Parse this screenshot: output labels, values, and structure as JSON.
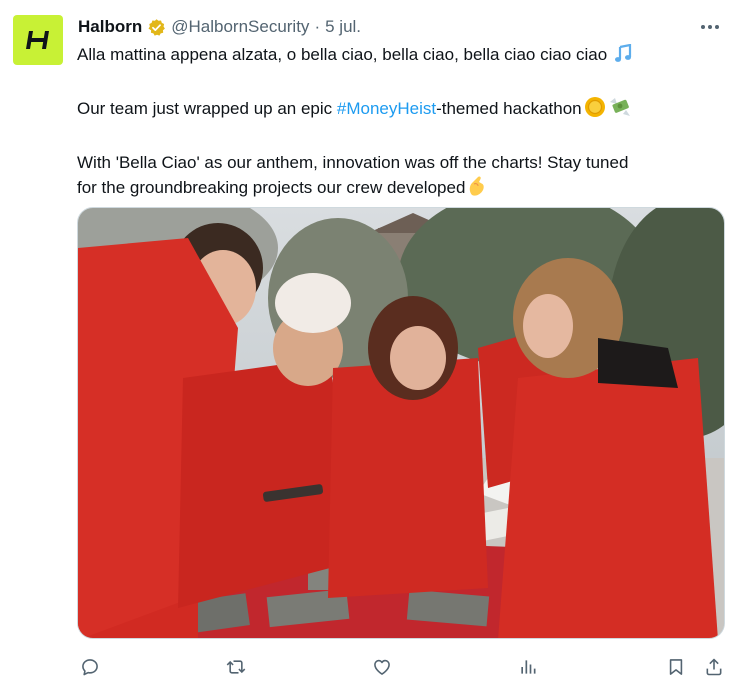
{
  "tweet": {
    "author": {
      "display_name": "Halborn",
      "handle": "@HalbornSecurity",
      "verified": true,
      "avatar_icon": "halborn-logo-icon",
      "avatar_color": "#c8f135"
    },
    "separator": "·",
    "date": "5 jul.",
    "lines": {
      "line1": "Alla mattina appena alzata, o bella ciao, bella ciao, bella ciao ciao ciao",
      "line2_before": "Our team just wrapped up an epic ",
      "hashtag": "#MoneyHeist",
      "line2_after": "-themed hackathon",
      "line3_a": "With 'Bella Ciao' as our anthem, innovation was off the charts! Stay tuned",
      "line3_b": "for the groundbreaking projects our crew developed"
    },
    "emojis": [
      "music-notes-icon",
      "coin-icon",
      "money-with-wings-icon",
      "pinching-hand-icon"
    ],
    "colors": {
      "accent": "#1d9bf0",
      "text": "#0f1419",
      "secondary": "#536471",
      "verified_badge": "#e2b719"
    }
  },
  "actions": [
    "reply-icon",
    "retweet-icon",
    "like-icon",
    "views-icon",
    "bookmark-icon",
    "share-icon"
  ],
  "more_icon": "more-options-icon"
}
